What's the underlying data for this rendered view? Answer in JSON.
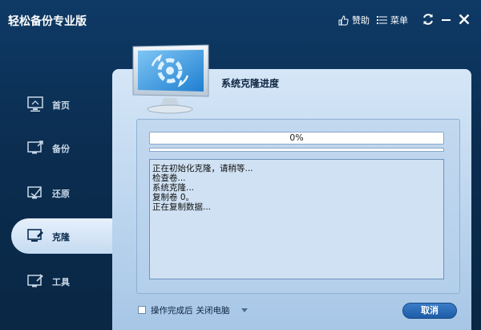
{
  "app": {
    "title": "轻松备份专业版"
  },
  "titlebar": {
    "like_label": "赞助",
    "menu_label": "菜单"
  },
  "sidebar": {
    "items": [
      {
        "label": "首页"
      },
      {
        "label": "备份"
      },
      {
        "label": "还原"
      },
      {
        "label": "克隆"
      },
      {
        "label": "工具"
      }
    ],
    "active_index": 3
  },
  "main": {
    "title": "系统克隆进度",
    "progress": {
      "percent_text": "0%",
      "value": 0
    },
    "log": [
      "正在初始化克隆，请稍等...",
      "检查卷...",
      "系统克隆...",
      "复制卷 0。",
      "正在复制数据..."
    ],
    "option": {
      "label": "操作完成后",
      "selected": "关闭电脑"
    },
    "cancel_label": "取消"
  },
  "colors": {
    "accent": "#1d5ba6",
    "background": "#0b2d50",
    "panel": "#c5dbf1"
  }
}
